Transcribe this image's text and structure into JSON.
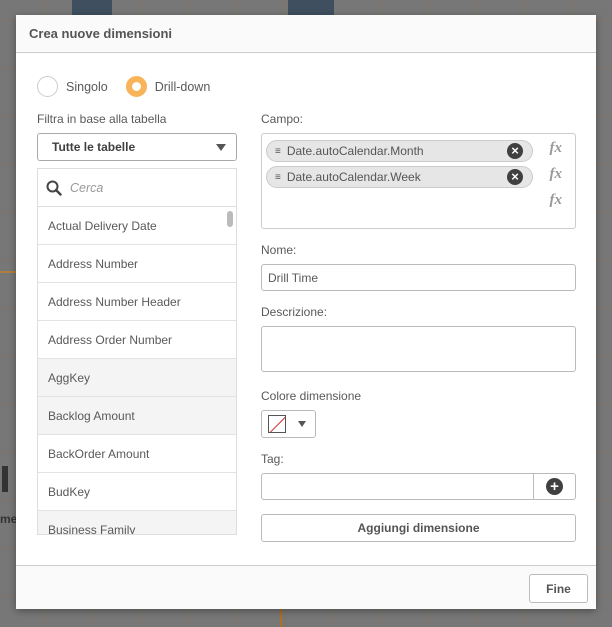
{
  "dialog": {
    "title": "Crea nuove dimensioni",
    "done_label": "Fine"
  },
  "mode": {
    "options": [
      {
        "label": "Singolo",
        "selected": false
      },
      {
        "label": "Drill-down",
        "selected": true
      }
    ],
    "accent_color": "#f8b45a"
  },
  "filter": {
    "label": "Filtra in base alla tabella",
    "selected": "Tutte le tabelle"
  },
  "field_list": {
    "search_placeholder": "Cerca",
    "items": [
      "Actual Delivery Date",
      "Address Number",
      "Address Number Header",
      "Address Order Number",
      "AggKey",
      "Backlog Amount",
      "BackOrder Amount",
      "BudKey",
      "Business Family"
    ]
  },
  "form": {
    "campo_label": "Campo:",
    "fields": [
      "Date.autoCalendar.Month",
      "Date.autoCalendar.Week"
    ],
    "fx_label": "fx",
    "name_label": "Nome:",
    "name_value": "Drill Time",
    "description_label": "Descrizione:",
    "description_value": "",
    "color_label": "Colore dimensione",
    "tag_label": "Tag:",
    "tag_value": "",
    "add_button_label": "Aggiungi dimensione"
  },
  "background": {
    "partial_text": "me"
  }
}
